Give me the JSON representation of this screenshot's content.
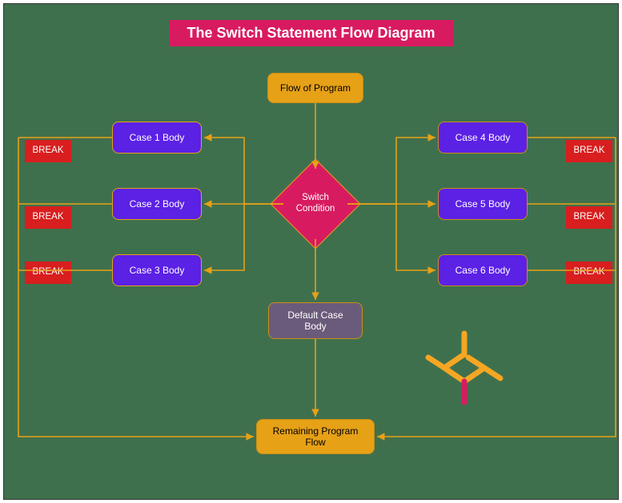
{
  "title": "The Switch Statement Flow Diagram",
  "flow_of_program": "Flow of Program",
  "switch_condition": "Switch\nCondition",
  "default_case": "Default Case\nBody",
  "remaining": "Remaining Program\nFlow",
  "cases": {
    "left": [
      {
        "label": "Case 1 Body"
      },
      {
        "label": "Case 2 Body"
      },
      {
        "label": "Case 3 Body"
      }
    ],
    "right": [
      {
        "label": "Case 4 Body"
      },
      {
        "label": "Case 5 Body"
      },
      {
        "label": "Case 6 Body"
      }
    ]
  },
  "break_label": "BREAK",
  "colors": {
    "background": "#3f704d",
    "title_bg": "#d81b60",
    "arrow": "#e6a117",
    "case": "#5b21e5",
    "break": "#d81e1e",
    "switch": "#d81b60",
    "default": "#6b5b7b",
    "flow_node": "#e6a117"
  }
}
